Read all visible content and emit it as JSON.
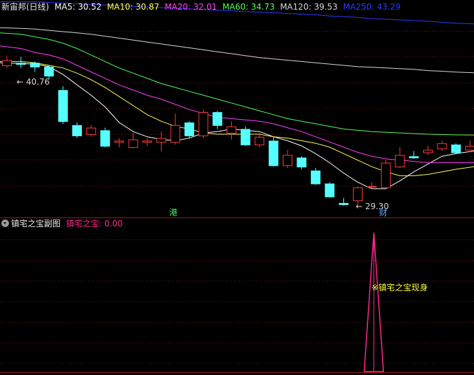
{
  "main_header": {
    "title": "新宙邦(日线)",
    "ma": [
      {
        "label": "MA5: 30.52",
        "color": "#ffffff"
      },
      {
        "label": "MA10: 30.87",
        "color": "#ffff55"
      },
      {
        "label": "MA20: 32.01",
        "color": "#ff40ff"
      },
      {
        "label": "MA60: 34.73",
        "color": "#55ff55"
      },
      {
        "label": "MA120: 39.53",
        "color": "#d8d8d8"
      },
      {
        "label": "MA250: 43.29",
        "color": "#2a3cff"
      }
    ]
  },
  "sub_header": {
    "title": "镇宅之宝副图",
    "indicator": "镇宅之宝: 0.00",
    "indicator_color": "#ff2a8a"
  },
  "annotations": {
    "high_label": "← 40.76",
    "low_label": "← 29.30",
    "event_1": "港",
    "event_1_color": "#33ff66",
    "event_2": "财",
    "event_2_color": "#5aa8ff",
    "signal_text": "※镇宅之宝现身",
    "signal_color": "#ffff33"
  },
  "colors": {
    "up": "#ff3a3a",
    "down": "#55ffff",
    "grid": "#7a1515",
    "border": "#a01414"
  },
  "chart_data": {
    "type": "candlestick",
    "price_range": [
      28.6,
      44.5
    ],
    "candles": [
      {
        "o": 40.1,
        "c": 40.5,
        "h": 40.8,
        "l": 39.9
      },
      {
        "o": 40.3,
        "c": 40.2,
        "h": 40.76,
        "l": 39.9
      },
      {
        "o": 40.3,
        "c": 40.0,
        "h": 40.4,
        "l": 39.6
      },
      {
        "o": 40.0,
        "c": 39.3,
        "h": 40.1,
        "l": 39.0
      },
      {
        "o": 38.2,
        "c": 35.8,
        "h": 38.5,
        "l": 35.6
      },
      {
        "o": 35.5,
        "c": 34.7,
        "h": 35.7,
        "l": 34.5
      },
      {
        "o": 34.8,
        "c": 35.3,
        "h": 35.5,
        "l": 34.6
      },
      {
        "o": 35.1,
        "c": 33.9,
        "h": 35.3,
        "l": 33.8
      },
      {
        "o": 34.2,
        "c": 34.3,
        "h": 34.5,
        "l": 33.8
      },
      {
        "o": 33.8,
        "c": 34.4,
        "h": 34.9,
        "l": 33.7
      },
      {
        "o": 34.2,
        "c": 34.3,
        "h": 34.5,
        "l": 33.9
      },
      {
        "o": 34.2,
        "c": 34.5,
        "h": 35.0,
        "l": 33.5
      },
      {
        "o": 34.2,
        "c": 35.5,
        "h": 36.4,
        "l": 34.0
      },
      {
        "o": 35.7,
        "c": 34.7,
        "h": 35.8,
        "l": 34.5
      },
      {
        "o": 34.7,
        "c": 36.5,
        "h": 36.7,
        "l": 34.5
      },
      {
        "o": 36.5,
        "c": 35.5,
        "h": 36.6,
        "l": 35.2
      },
      {
        "o": 34.9,
        "c": 35.4,
        "h": 35.8,
        "l": 34.4
      },
      {
        "o": 35.2,
        "c": 34.0,
        "h": 35.4,
        "l": 33.9
      },
      {
        "o": 34.0,
        "c": 34.6,
        "h": 34.9,
        "l": 33.8
      },
      {
        "o": 34.3,
        "c": 32.4,
        "h": 34.6,
        "l": 32.3
      },
      {
        "o": 32.4,
        "c": 33.2,
        "h": 33.6,
        "l": 32.2
      },
      {
        "o": 33.0,
        "c": 32.3,
        "h": 33.1,
        "l": 32.1
      },
      {
        "o": 32.0,
        "c": 31.0,
        "h": 32.2,
        "l": 30.9
      },
      {
        "o": 31.0,
        "c": 30.0,
        "h": 31.1,
        "l": 29.9
      },
      {
        "o": 29.5,
        "c": 29.4,
        "h": 29.9,
        "l": 29.3
      },
      {
        "o": 29.7,
        "c": 30.7,
        "h": 30.8,
        "l": 29.3
      },
      {
        "o": 30.8,
        "c": 30.8,
        "h": 31.1,
        "l": 30.6
      },
      {
        "o": 30.7,
        "c": 32.6,
        "h": 32.8,
        "l": 30.6
      },
      {
        "o": 32.3,
        "c": 33.2,
        "h": 33.8,
        "l": 32.2
      },
      {
        "o": 33.1,
        "c": 33.0,
        "h": 33.5,
        "l": 32.9
      },
      {
        "o": 33.4,
        "c": 33.6,
        "h": 33.9,
        "l": 33.2
      },
      {
        "o": 33.7,
        "c": 34.1,
        "h": 34.3,
        "l": 33.5
      },
      {
        "o": 34.0,
        "c": 33.4,
        "h": 34.1,
        "l": 33.3
      },
      {
        "o": 33.6,
        "c": 33.9,
        "h": 34.3,
        "l": 33.4
      }
    ],
    "ma_lines": [
      {
        "name": "MA5",
        "color": "#ffffff",
        "values": [
          40.3,
          40.25,
          40.2,
          40.0,
          39.4,
          38.6,
          37.8,
          36.9,
          35.7,
          35.0,
          34.6,
          34.4,
          34.3,
          34.5,
          34.9,
          35.0,
          35.2,
          35.1,
          35.0,
          34.6,
          34.3,
          33.9,
          33.3,
          32.6,
          31.8,
          31.1,
          30.6,
          30.6,
          31.2,
          31.9,
          32.5,
          33.1,
          33.3,
          33.5
        ]
      },
      {
        "name": "MA10",
        "color": "#ffff55",
        "values": [
          40.4,
          40.4,
          40.3,
          40.1,
          39.9,
          39.5,
          39.0,
          38.4,
          37.7,
          37.0,
          36.3,
          35.8,
          35.4,
          35.2,
          34.9,
          34.8,
          34.8,
          34.8,
          34.8,
          34.6,
          34.5,
          34.3,
          34.1,
          33.8,
          33.3,
          32.8,
          32.3,
          31.9,
          31.6,
          31.6,
          31.7,
          31.9,
          32.1,
          32.3
        ]
      },
      {
        "name": "MA20",
        "color": "#ff40ff",
        "values": [
          41.6,
          41.4,
          41.1,
          40.9,
          40.6,
          40.1,
          39.6,
          39.1,
          38.6,
          38.2,
          37.8,
          37.5,
          37.1,
          36.7,
          36.4,
          36.1,
          36.0,
          35.9,
          35.8,
          35.6,
          35.3,
          35.0,
          34.6,
          34.2,
          33.8,
          33.4,
          33.1,
          32.9,
          32.8,
          32.7,
          32.6,
          32.6,
          32.6,
          32.6
        ]
      },
      {
        "name": "MA60",
        "color": "#55ff55",
        "values": [
          42.6,
          42.5,
          42.3,
          42.1,
          41.8,
          41.4,
          40.9,
          40.4,
          39.9,
          39.5,
          39.1,
          38.7,
          38.4,
          38.1,
          37.8,
          37.5,
          37.2,
          36.9,
          36.6,
          36.3,
          36.0,
          35.8,
          35.6,
          35.4,
          35.2,
          35.1,
          35.0,
          34.95,
          34.9,
          34.85,
          34.8,
          34.78,
          34.75,
          34.73
        ]
      },
      {
        "name": "MA120",
        "color": "#d8d8d8",
        "values": [
          43.0,
          42.95,
          42.9,
          42.8,
          42.7,
          42.6,
          42.5,
          42.35,
          42.2,
          42.05,
          41.9,
          41.75,
          41.6,
          41.45,
          41.3,
          41.15,
          41.0,
          40.85,
          40.7,
          40.6,
          40.5,
          40.4,
          40.3,
          40.2,
          40.1,
          40.0,
          39.95,
          39.9,
          39.85,
          39.8,
          39.7,
          39.65,
          39.58,
          39.53
        ]
      },
      {
        "name": "MA250",
        "color": "#2a3cff",
        "values": [
          45.0,
          45.0,
          45.0,
          44.95,
          44.9,
          44.85,
          44.8,
          44.75,
          44.7,
          44.65,
          44.6,
          44.55,
          44.5,
          44.45,
          44.4,
          44.35,
          44.3,
          44.25,
          44.2,
          44.15,
          44.1,
          44.05,
          44.0,
          43.9,
          43.85,
          43.8,
          43.7,
          43.65,
          43.6,
          43.55,
          43.5,
          43.42,
          43.35,
          43.29
        ]
      }
    ],
    "signal": {
      "index": 26,
      "value": 1,
      "range": [
        0,
        1
      ]
    }
  }
}
